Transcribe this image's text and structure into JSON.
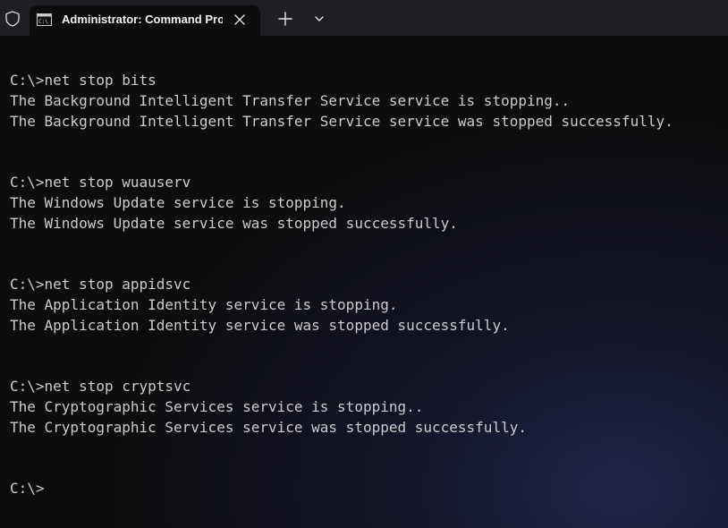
{
  "window": {
    "tab_title": "Administrator: Command Pro"
  },
  "icons": {
    "shield": "shield-icon",
    "cmd": "command-prompt-icon",
    "close": "close-icon",
    "new_tab": "plus-icon",
    "dropdown": "chevron-down-icon"
  },
  "terminal": {
    "lines": [
      "C:\\>net stop bits",
      "The Background Intelligent Transfer Service service is stopping..",
      "The Background Intelligent Transfer Service service was stopped successfully.",
      "C:\\>net stop wuauserv",
      "The Windows Update service is stopping.",
      "The Windows Update service was stopped successfully.",
      "C:\\>net stop appidsvc",
      "The Application Identity service is stopping.",
      "The Application Identity service was stopped successfully.",
      "C:\\>net stop cryptsvc",
      "The Cryptographic Services service is stopping..",
      "The Cryptographic Services service was stopped successfully.",
      "C:\\>"
    ]
  }
}
